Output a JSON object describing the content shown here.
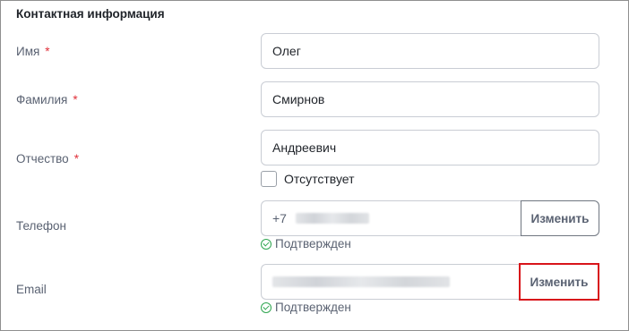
{
  "section": {
    "title": "Контактная информация"
  },
  "fields": {
    "first_name": {
      "label": "Имя",
      "required": "*",
      "value": "Олег"
    },
    "last_name": {
      "label": "Фамилия",
      "required": "*",
      "value": "Смирнов"
    },
    "patronymic": {
      "label": "Отчество",
      "required": "*",
      "value": "Андреевич",
      "absent_label": "Отсутствует",
      "absent_checked": false
    },
    "phone": {
      "label": "Телефон",
      "prefix": "+7",
      "button": "Изменить",
      "status": "Подтвержден"
    },
    "email": {
      "label": "Email",
      "button": "Изменить",
      "status": "Подтвержден"
    }
  },
  "colors": {
    "required": "#e0313a",
    "verified": "#2fa650",
    "highlight": "#d8141a"
  }
}
